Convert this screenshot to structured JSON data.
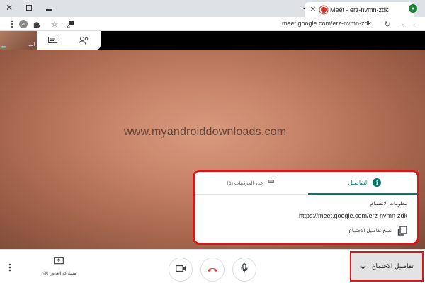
{
  "browser": {
    "tab_title": "Meet - erz-nvmn-zdk",
    "url": "meet.google.com/erz-nvmn-zdk",
    "profile_initial": "a"
  },
  "meet": {
    "self_name": "أنت",
    "watermark": "www.myandroiddownloads.com",
    "details_card": {
      "tab_details_label": "التفاصيل",
      "tab_attachments_label": "عدد المرفقات (٥)",
      "join_info_title": "معلومات الانضمام",
      "join_url": "https://meet.google.com/erz-nvmn-zdk",
      "copy_label": "نسخ تفاصيل الاجتماع"
    },
    "controls": {
      "present_label": "مشاركة العرض الآن",
      "meeting_details_label": "تفاصيل الاجتماع"
    }
  },
  "colors": {
    "accent": "#00796b",
    "highlight": "#e01414",
    "end_call": "#d93025"
  }
}
